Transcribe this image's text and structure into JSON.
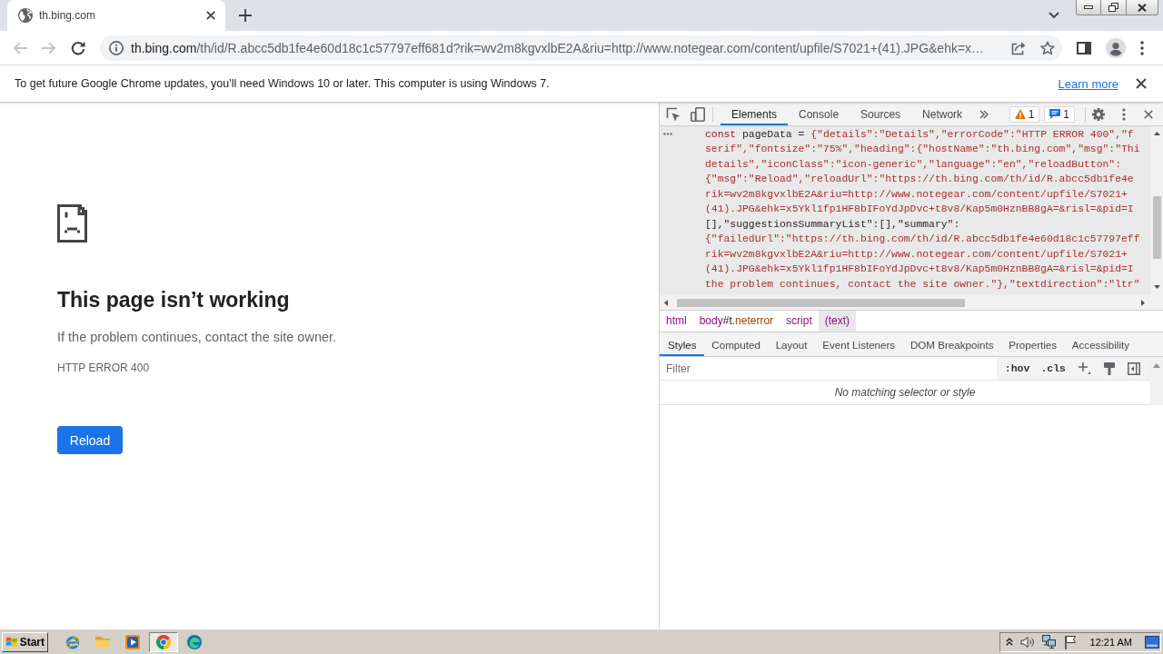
{
  "tabs": [
    {
      "title": "th.bing.com",
      "selected": true
    }
  ],
  "toolbar": {
    "nav": [
      {
        "kind": "back",
        "disabled": true
      },
      {
        "kind": "forward",
        "disabled": true
      },
      {
        "kind": "reload",
        "disabled": false
      }
    ],
    "omnibox": {
      "host": "th.bing.com",
      "path": "/th/id/R.abcc5db1fe4e60d18c1c57797eff681d?rik=wv2m8kgvxlbE2A&riu=http://www.notegear.com/content/upfile/S7021+(41).JPG&ehk=x…",
      "bookmarked": false
    }
  },
  "infobar": {
    "message": "To get future Google Chrome updates, you'll need Windows 10 or later. This computer is using Windows 7.",
    "link": "Learn more"
  },
  "page": {
    "heading": "This page isn’t working",
    "message": "If the problem continues, contact the site owner.",
    "error_code": "HTTP ERROR 400",
    "button": "Reload"
  },
  "devtools": {
    "tabs": [
      {
        "label": "Elements",
        "selected": true
      },
      {
        "label": "Console",
        "selected": false
      },
      {
        "label": "Sources",
        "selected": false
      },
      {
        "label": "Network",
        "selected": false
      }
    ],
    "warnings": "1",
    "messages": "1",
    "code_lines": [
      {
        "segments": [
          {
            "kind": "keyword",
            "text": "const"
          },
          {
            "kind": "plain",
            "text": " pageData = "
          },
          {
            "kind": "string",
            "text": "{\"details\":\"Details\",\"errorCode\":\"HTTP ERROR 400\",\"f"
          }
        ]
      },
      {
        "segments": [
          {
            "kind": "string",
            "text": "serif\",\"fontsize\":\"75%\",\"heading\":{\"hostName\":\"th.bing.com\",\"msg\":\"Thi"
          }
        ]
      },
      {
        "segments": [
          {
            "kind": "string",
            "text": "details\",\"iconClass\":\"icon-generic\",\"language\":\"en\",\"reloadButton\":"
          }
        ]
      },
      {
        "segments": [
          {
            "kind": "string",
            "text": "{\"msg\":\"Reload\",\"reloadUrl\":\"https://th.bing.com/th/id/R.abcc5db1fe4e"
          }
        ]
      },
      {
        "segments": [
          {
            "kind": "string",
            "text": "rik=wv2m8kgvxlbE2A&riu=http://www.notegear.com/content/upfile/S7021+"
          }
        ]
      },
      {
        "segments": [
          {
            "kind": "string",
            "text": "(41).JPG&ehk=x5Ykl1fp1HF8bIFoYdJpDvc+t8v8/Kap5m0HznBB8gA=&risl=&pid=I"
          }
        ]
      },
      {
        "segments": [
          {
            "kind": "plain",
            "text": "[],\"suggestionsSummaryList\":[],\"summary\":"
          }
        ]
      },
      {
        "segments": [
          {
            "kind": "string",
            "text": "{\"failedUrl\":\"https://th.bing.com/th/id/R.abcc5db1fe4e60d18c1c57797eff"
          }
        ]
      },
      {
        "segments": [
          {
            "kind": "string",
            "text": "rik=wv2m8kgvxlbE2A&riu=http://www.notegear.com/content/upfile/S7021+"
          }
        ]
      },
      {
        "segments": [
          {
            "kind": "string",
            "text": "(41).JPG&ehk=x5Ykl1fp1HF8bIFoYdJpDvc+t8v8/Kap5m0HznBB8gA=&risl=&pid=I"
          }
        ]
      },
      {
        "segments": [
          {
            "kind": "string",
            "text": "the problem continues, contact the site owner.\"},\"textdirection\":\"ltr\""
          }
        ]
      }
    ],
    "breadcrumbs": [
      {
        "label": "html",
        "selected": false
      },
      {
        "label": "body",
        "id": "#t",
        "classes": ".neterror",
        "selected": false
      },
      {
        "label": "script",
        "selected": false
      },
      {
        "label": "(text)",
        "selected": true
      }
    ],
    "pane_tabs": [
      {
        "label": "Styles",
        "selected": true
      },
      {
        "label": "Computed",
        "selected": false
      },
      {
        "label": "Layout",
        "selected": false
      },
      {
        "label": "Event Listeners",
        "selected": false
      },
      {
        "label": "DOM Breakpoints",
        "selected": false
      },
      {
        "label": "Properties",
        "selected": false
      },
      {
        "label": "Accessibility",
        "selected": false
      }
    ],
    "filter": {
      "placeholder": "Filter"
    },
    "filter_buttons": [
      ":hov",
      ".cls"
    ],
    "empty_message": "No matching selector or style"
  },
  "taskbar": {
    "start": "Start",
    "apps": [
      {
        "kind": "ie",
        "active": false
      },
      {
        "kind": "folder",
        "active": false
      },
      {
        "kind": "media",
        "active": false
      },
      {
        "kind": "chrome",
        "active": true
      },
      {
        "kind": "edge",
        "active": false
      }
    ],
    "clock": "12:21 AM"
  }
}
